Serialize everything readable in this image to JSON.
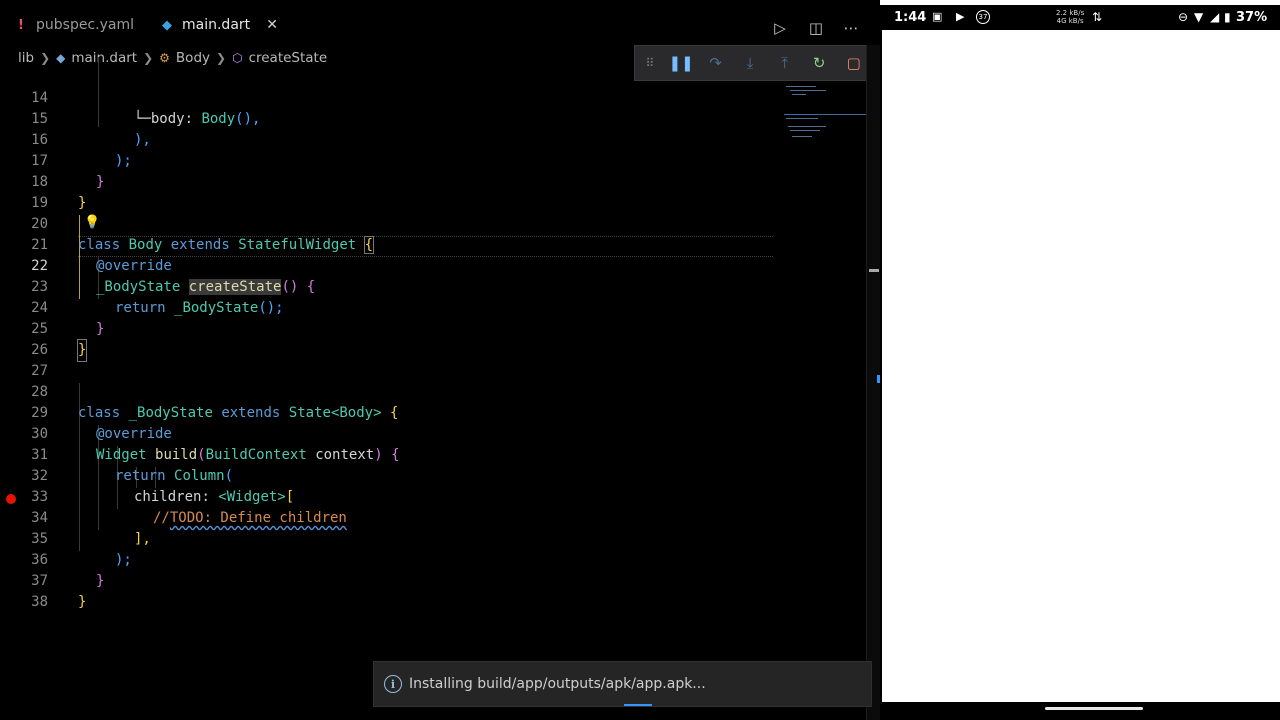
{
  "tabs": [
    {
      "label": "pubspec.yaml",
      "icon": "yaml-exclamation-icon",
      "active": false
    },
    {
      "label": "main.dart",
      "icon": "dart-icon",
      "active": true
    }
  ],
  "editor_actions": {
    "run": "run-icon",
    "split": "split-editor-icon",
    "more": "more-actions-icon"
  },
  "breadcrumb": [
    "lib",
    "main.dart",
    "Body",
    "createState"
  ],
  "debug_toolbar": [
    "drag-grip-icon",
    "pause-icon",
    "step-over-icon",
    "step-into-icon",
    "step-out-icon",
    "restart-icon",
    "stop-icon"
  ],
  "code": {
    "line_numbers": [
      "14",
      "15",
      "16",
      "17",
      "18",
      "19",
      "20",
      "21",
      "22",
      "23",
      "24",
      "25",
      "26",
      "27",
      "28",
      "29",
      "30",
      "31",
      "32",
      "33",
      "34",
      "35",
      "36",
      "37",
      "38"
    ],
    "l14_body": "body",
    "l14_colon": ": ",
    "l14_call": "Body",
    "l14_tail": "(),",
    "l15": "),",
    "l16": ");",
    "l17": "}",
    "l18": "}",
    "l20_class": "class",
    "l20_name": "Body",
    "l20_extends": "extends",
    "l20_super": "StatefulWidget",
    "l20_brace": "{",
    "l21": "@override",
    "l22_type": "_BodyState",
    "l22_fn": "createState",
    "l22_tail": "() {",
    "l23_return": "return",
    "l23_call": "_BodyState",
    "l23_tail": "();",
    "l24": "}",
    "l25": "}",
    "l28_class": "class",
    "l28_name": "_BodyState",
    "l28_extends": "extends",
    "l28_super": "State",
    "l28_generic": "<Body>",
    "l28_brace": "{",
    "l29": "@override",
    "l30_type": "Widget",
    "l30_fn": "build",
    "l30_param_type": "BuildContext",
    "l30_param": "context",
    "l30_tail": ") {",
    "l31_return": "return",
    "l31_call": "Column",
    "l31_tail": "(",
    "l32_prop": "children",
    "l32_generic": "<Widget>",
    "l32_tail": "[",
    "l33_prefix": "//",
    "l33_todo": "TODO: Define children",
    "l34": "],",
    "l35": ");",
    "l36": "}",
    "l37": "}"
  },
  "breakpoint_line": "34",
  "notification": {
    "icon": "info-icon",
    "text": "Installing build/app/outputs/apk/app.apk..."
  },
  "phone": {
    "time": "1:44",
    "net_up": "2.2 kB/s",
    "net_type": "4G kB/s",
    "battery": "37%"
  },
  "colors": {
    "keyword": "#5c9bd6",
    "type": "#4ec9b0",
    "function": "#dcdcaa",
    "comment": "#d88a4e",
    "breakpoint": "#e51400"
  }
}
